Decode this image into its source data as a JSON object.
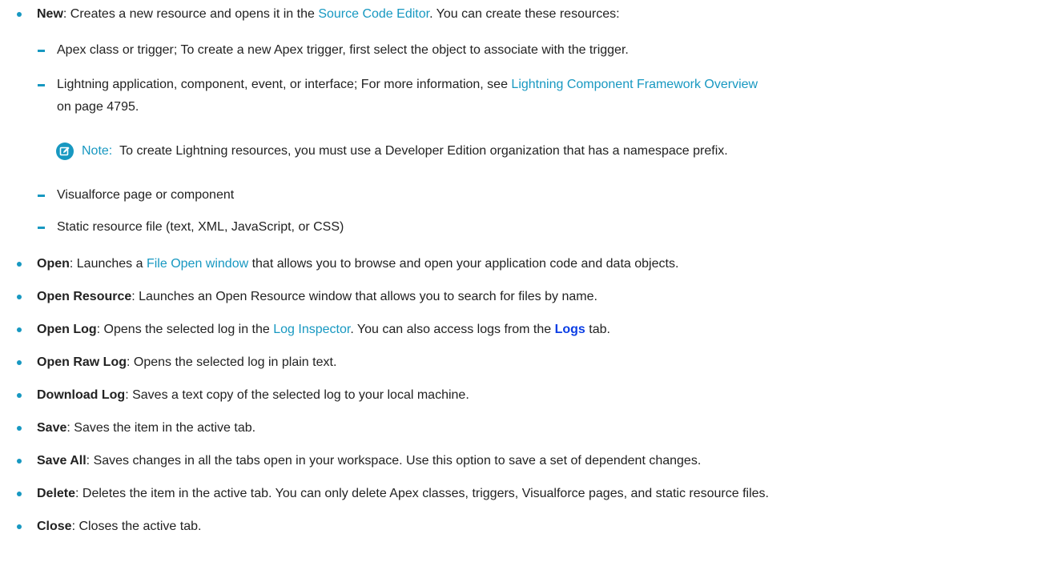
{
  "colors": {
    "accent": "#1798c1",
    "ui_label": "#0b3ee5",
    "text": "#222222"
  },
  "items": [
    {
      "term": "New",
      "text_before": ": Creates a new resource and opens it in the ",
      "link": "Source Code Editor",
      "text_after": ". You can create these resources:"
    },
    {
      "term": "Open",
      "text_before": ": Launches a ",
      "link": "File Open window",
      "text_after": " that allows you to browse and open your application code and data objects."
    },
    {
      "term": "Open Resource",
      "text": ": Launches an Open Resource window that allows you to search for files by name."
    },
    {
      "term": "Open Log",
      "text_before": ": Opens the selected log in the ",
      "link": "Log Inspector",
      "text_middle": ". You can also access logs from the ",
      "ui_label": "Logs",
      "text_after": " tab."
    },
    {
      "term": "Open Raw Log",
      "text": ": Opens the selected log in plain text."
    },
    {
      "term": "Download Log",
      "text": ": Saves a text copy of the selected log to your local machine."
    },
    {
      "term": "Save",
      "text": ": Saves the item in the active tab."
    },
    {
      "term": "Save All",
      "text": ": Saves changes in all the tabs open in your workspace. Use this option to save a set of dependent changes."
    },
    {
      "term": "Delete",
      "text": ": Deletes the item in the active tab. You can only delete Apex classes, triggers, Visualforce pages, and static resource files."
    },
    {
      "term": "Close",
      "text": ": Closes the active tab."
    }
  ],
  "subitems": [
    {
      "text": "Apex class or trigger; To create a new Apex trigger, first select the object to associate with the trigger."
    },
    {
      "text_before": "Lightning application, component, event, or interface; For more information, see ",
      "link": "Lightning Component Framework Overview",
      "text_after_line2": "on page 4795."
    },
    {
      "text": "Visualforce page or component"
    },
    {
      "text": "Static resource file (text, XML, JavaScript, or CSS)"
    }
  ],
  "note": {
    "icon": "note-edit-icon",
    "label": "Note:",
    "text": "To create Lightning resources, you must use a Developer Edition organization that has a namespace prefix."
  }
}
